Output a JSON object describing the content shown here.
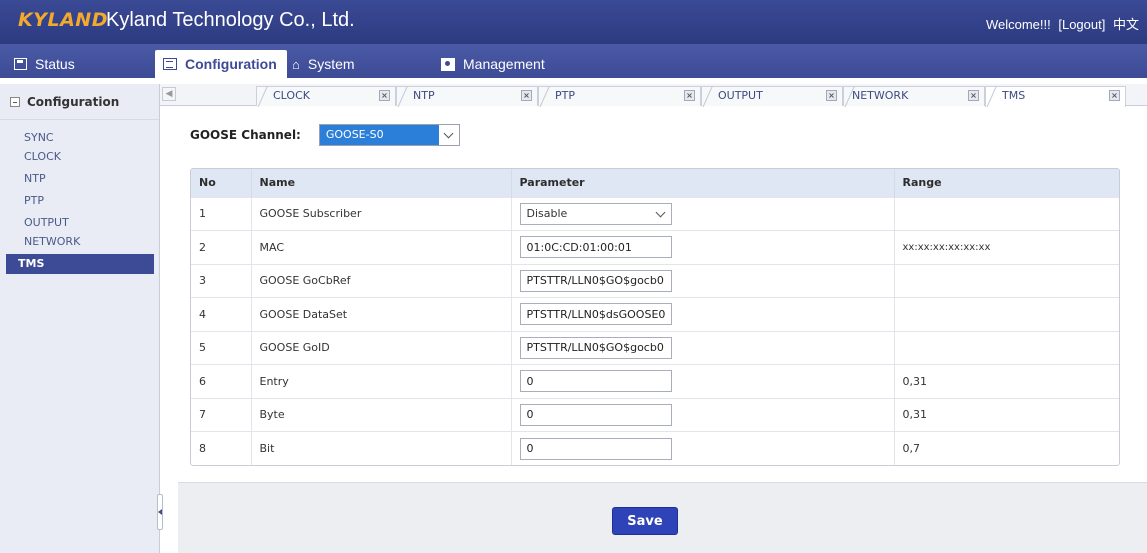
{
  "header": {
    "logo_text": "KYLAND",
    "company": "Kyland Technology Co., Ltd.",
    "welcome": "Welcome!!!",
    "logout": "[Logout]",
    "language": "中文"
  },
  "mainnav": {
    "status": "Status",
    "configuration": "Configuration",
    "system": "System",
    "management": "Management"
  },
  "sidebar": {
    "title": "Configuration",
    "items": [
      {
        "label": "SYNC"
      },
      {
        "label": "CLOCK"
      },
      {
        "label": "NTP"
      },
      {
        "label": "PTP"
      },
      {
        "label": "OUTPUT"
      },
      {
        "label": "NETWORK"
      },
      {
        "label": "TMS",
        "active": true
      }
    ]
  },
  "tabs": [
    {
      "label": "CLOCK"
    },
    {
      "label": "NTP"
    },
    {
      "label": "PTP"
    },
    {
      "label": "OUTPUT"
    },
    {
      "label": "NETWORK"
    },
    {
      "label": "TMS",
      "active": true
    }
  ],
  "tab_close_glyph": "×",
  "channel": {
    "label": "GOOSE Channel:",
    "value": "GOOSE-S0"
  },
  "table": {
    "headers": [
      "No",
      "Name",
      "Parameter",
      "Range"
    ],
    "rows": [
      {
        "no": "1",
        "name": "GOOSE Subscriber",
        "param": "Disable",
        "range": ""
      },
      {
        "no": "2",
        "name": "MAC",
        "param": "01:0C:CD:01:00:01",
        "range": "xx:xx:xx:xx:xx:xx"
      },
      {
        "no": "3",
        "name": "GOOSE GoCbRef",
        "param": "PTSTTR/LLN0$GO$gocb0",
        "range": ""
      },
      {
        "no": "4",
        "name": "GOOSE DataSet",
        "param": "PTSTTR/LLN0$dsGOOSE0",
        "range": ""
      },
      {
        "no": "5",
        "name": "GOOSE GoID",
        "param": "PTSTTR/LLN0$GO$gocb0",
        "range": ""
      },
      {
        "no": "6",
        "name": "Entry",
        "param": "0",
        "range": "0,31"
      },
      {
        "no": "7",
        "name": "Byte",
        "param": "0",
        "range": "0,31"
      },
      {
        "no": "8",
        "name": "Bit",
        "param": "0",
        "range": "0,7"
      }
    ]
  },
  "save_label": "Save",
  "colors": {
    "header_bg": "#2c3a80",
    "logo": "#f2a92e",
    "accent": "#3d4b96",
    "select_highlight": "#2b7fd8",
    "save_button": "#2f43b8"
  }
}
